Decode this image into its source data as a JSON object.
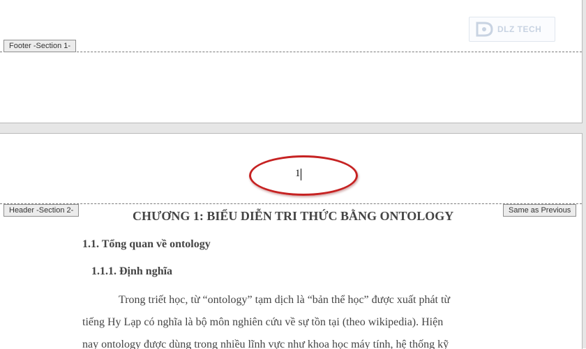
{
  "watermark": {
    "brand": "DLZ TECH",
    "color": "#c8d3e2"
  },
  "page1": {
    "footer_tag": "Footer -Section 1-"
  },
  "page2": {
    "header_tag": "Header -Section 2-",
    "same_as_previous": "Same as Previous",
    "page_number": "1",
    "highlight_color": "#c62222"
  },
  "document": {
    "chapter_title": "CHƯƠNG 1:  BIỂU DIỄN TRI THỨC BẰNG ONTOLOGY",
    "heading_1": "1.1.  Tổng quan về ontology",
    "heading_2": "1.1.1.  Định nghĩa",
    "body_lines": [
      "Trong triết học, từ “ontology” tạm dịch là “bản thể học” được xuất phát từ",
      "tiếng Hy Lạp có nghĩa là bộ môn nghiên cứu về sự tồn tại (theo wikipedia). Hiện",
      "nay ontology được dùng trong nhiều lĩnh vực như khoa học máy tính, hệ thống kỹ"
    ]
  }
}
